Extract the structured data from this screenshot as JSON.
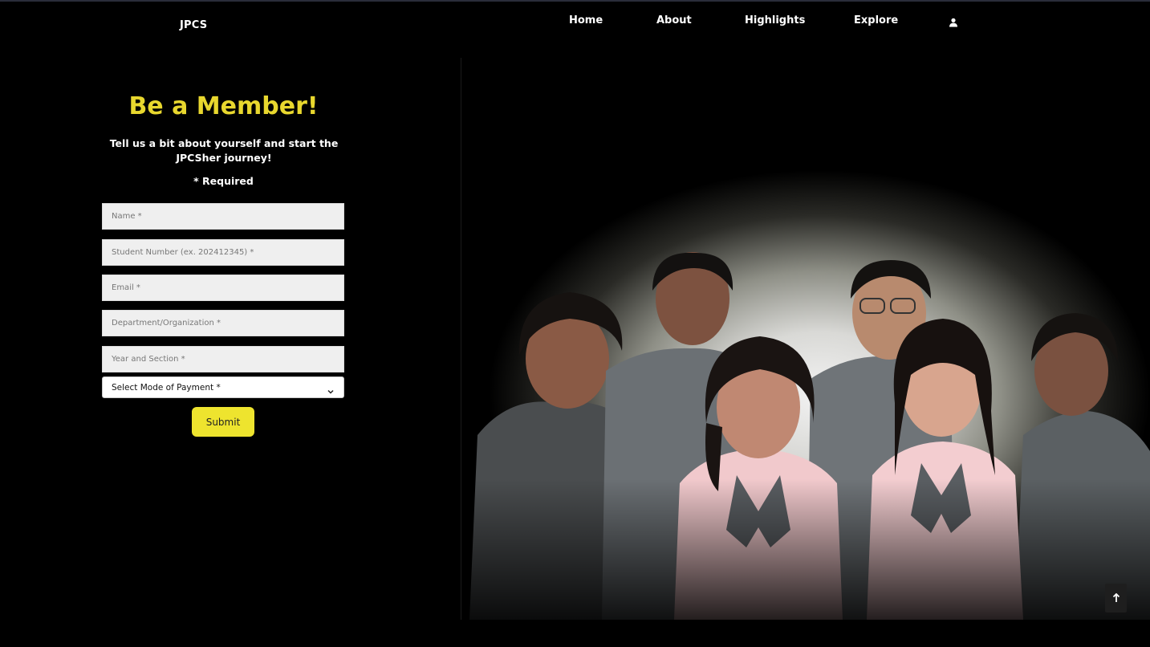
{
  "brand": "JPCS",
  "nav": {
    "home": "Home",
    "about": "About",
    "highlights": "Highlights",
    "explore": "Explore",
    "account_icon": "user-icon"
  },
  "form": {
    "heading": "Be a Member!",
    "subtitle": "Tell us a bit about yourself and start the JPCSher journey!",
    "required_note": "* Required",
    "fields": {
      "name": {
        "placeholder": "Name *",
        "value": ""
      },
      "student_number": {
        "placeholder": "Student Number (ex. 202412345) *",
        "value": ""
      },
      "email": {
        "placeholder": "Email *",
        "value": ""
      },
      "department": {
        "placeholder": "Department/Organization *",
        "value": ""
      },
      "year_section": {
        "placeholder": "Year and Section *",
        "value": ""
      }
    },
    "payment_select": {
      "selected": "Select Mode of Payment *",
      "icon": "chevron-down-icon"
    },
    "submit_label": "Submit"
  },
  "scroll_top": {
    "icon": "arrow-up-icon"
  },
  "colors": {
    "background": "#000000",
    "accent": "#e8d72e",
    "button": "#eee42e",
    "input_bg": "#efefef"
  }
}
